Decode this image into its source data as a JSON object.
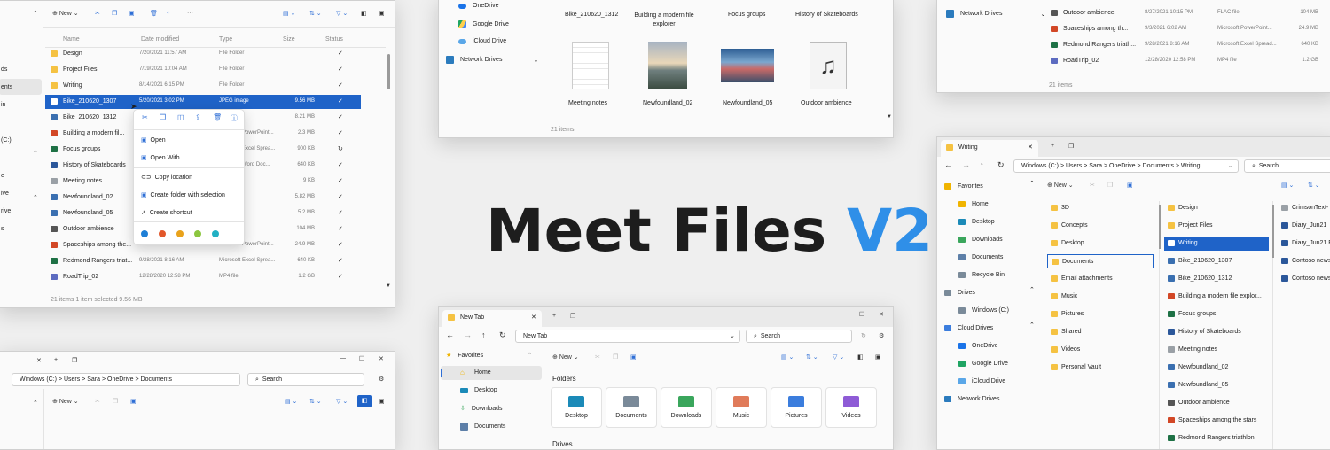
{
  "hero": {
    "title_main": "Meet Files",
    "title_version": "V2"
  },
  "colors": {
    "accent": "#2f8fe8",
    "selection": "#1f63c8",
    "folder": "#f5c242"
  },
  "w1": {
    "toolbar": {
      "new_label": "New"
    },
    "columns": [
      "Name",
      "Date modified",
      "Type",
      "Size",
      "Status"
    ],
    "sidebar_fragments": [
      "ds",
      "ents",
      "in",
      "(C:)",
      "e",
      "ive",
      "rive",
      "s"
    ],
    "rows": [
      {
        "name": "Design",
        "date": "7/20/2021 11:57 AM",
        "type": "File Folder",
        "size": "",
        "status": "✓"
      },
      {
        "name": "Project Files",
        "date": "7/19/2021 10:04 AM",
        "type": "File Folder",
        "size": "",
        "status": "✓"
      },
      {
        "name": "Writing",
        "date": "8/14/2021 6:15 PM",
        "type": "File Folder",
        "size": "",
        "status": "✓"
      },
      {
        "name": "Bike_210620_1307",
        "date": "5/20/2021 3:02 PM",
        "type": "JPEG image",
        "size": "9.56 MB",
        "status": "✓"
      },
      {
        "name": "Bike_210620_1312",
        "date": "",
        "type": "e",
        "size": "8.21 MB",
        "status": "✓"
      },
      {
        "name": "Building a modern fil...",
        "date": "",
        "type": "Microsoft PowerPoint...",
        "size": "2.3 MB",
        "status": "✓"
      },
      {
        "name": "Focus groups",
        "date": "",
        "type": "Microsoft Excel Sprea...",
        "size": "900 KB",
        "status": "↻"
      },
      {
        "name": "History of Skateboards",
        "date": "",
        "type": "Microsoft Word Doc...",
        "size": "640 KB",
        "status": "✓"
      },
      {
        "name": "Meeting notes",
        "date": "",
        "type": "Document",
        "size": "9 KB",
        "status": "✓"
      },
      {
        "name": "Newfoundland_02",
        "date": "",
        "type": "e",
        "size": "5.82 MB",
        "status": "✓"
      },
      {
        "name": "Newfoundland_05",
        "date": "",
        "type": "e",
        "size": "5.2 MB",
        "status": "✓"
      },
      {
        "name": "Outdoor ambience",
        "date": "",
        "type": "",
        "size": "104 MB",
        "status": "✓"
      },
      {
        "name": "Spaceships among the...",
        "date": "9/2/2021 10:52 AM",
        "type": "Microsoft PowerPoint...",
        "size": "24.9 MB",
        "status": "✓"
      },
      {
        "name": "Redmond Rangers triat...",
        "date": "9/28/2021 8:16 AM",
        "type": "Microsoft Excel Sprea...",
        "size": "640 KB",
        "status": "✓"
      },
      {
        "name": "RoadTrip_02",
        "date": "12/28/2020 12:58 PM",
        "type": "MP4 file",
        "size": "1.2 GB",
        "status": "✓"
      }
    ],
    "status_bar": "21 items   1 item selected   9.56 MB",
    "context_menu": [
      "Open",
      "Open With",
      "Copy location",
      "Create folder with selection",
      "Create shortcut"
    ],
    "tag_colors": [
      "#1e7fd6",
      "#e2572a",
      "#e9a21b",
      "#8cc63f",
      "#22b0c3"
    ]
  },
  "w2": {
    "nav": [
      "OneDrive",
      "Google Drive",
      "iCloud Drive",
      "Network Drives"
    ],
    "top_labels": [
      "Bike_210620_1312",
      "Building a modern file explorer",
      "Focus groups",
      "History of Skateboards"
    ],
    "thumbs": [
      "Meeting notes",
      "Newfoundland_02",
      "Newfoundland_05",
      "Outdoor ambience"
    ],
    "status": "21 items"
  },
  "w3": {
    "nav": [
      "Network Drives"
    ],
    "rows": [
      {
        "name": "Outdoor ambience",
        "date": "8/27/2021 10:15 PM",
        "type": "FLAC file",
        "size": "104 MB"
      },
      {
        "name": "Spaceships among th...",
        "date": "9/3/2021 6:02 AM",
        "type": "Microsoft PowerPoint...",
        "size": "24.9 MB"
      },
      {
        "name": "Redmond Rangers triath...",
        "date": "9/28/2021 8:16 AM",
        "type": "Microsoft Excel Spread...",
        "size": "640 KB"
      },
      {
        "name": "RoadTrip_02",
        "date": "12/28/2020 12:58 PM",
        "type": "MP4 file",
        "size": "1.2 GB"
      }
    ],
    "status": "21 items"
  },
  "w4": {
    "tab": "Writing",
    "breadcrumb": "Windows (C:)  >  Users  >  Sara  >  OneDrive  >  Documents  >  Writing",
    "search": "Search",
    "new_label": "New",
    "nav": [
      "Favorites",
      "Home",
      "Desktop",
      "Downloads",
      "Documents",
      "Recycle Bin",
      "Drives",
      "Windows (C:)",
      "Cloud Drives",
      "OneDrive",
      "Google Drive",
      "iCloud Drive",
      "Network Drives"
    ],
    "col1": [
      "3D",
      "Concepts",
      "Desktop",
      "Documents",
      "Email attachments",
      "Music",
      "Pictures",
      "Shared",
      "Videos",
      "Personal Vault"
    ],
    "col2": [
      "Design",
      "Project Files",
      "Writing",
      "Bike_210620_1307",
      "Bike_210620_1312",
      "Building a modern file explor...",
      "Focus groups",
      "History of Skateboards",
      "Meeting notes",
      "Newfoundland_02",
      "Newfoundland_05",
      "Outdoor ambience",
      "Spaceships among the stars",
      "Redmond Rangers triathlon"
    ],
    "col3": [
      "CrimsonText-",
      "Diary_Jun21",
      "Diary_Jun21 E",
      "Contoso news",
      "Contoso news"
    ]
  },
  "w5": {
    "breadcrumb": "Windows (C:)  >  Users  >  Sara  >  OneDrive  >  Documents",
    "search": "Search",
    "new_label": "New"
  },
  "w6": {
    "tab": "New Tab",
    "address": "New Tab",
    "search": "Search",
    "new_label": "New",
    "nav": [
      "Favorites",
      "Home",
      "Desktop",
      "Downloads",
      "Documents"
    ],
    "section_folders": "Folders",
    "section_drives": "Drives",
    "folders": [
      "Desktop",
      "Documents",
      "Downloads",
      "Music",
      "Pictures",
      "Videos"
    ]
  }
}
